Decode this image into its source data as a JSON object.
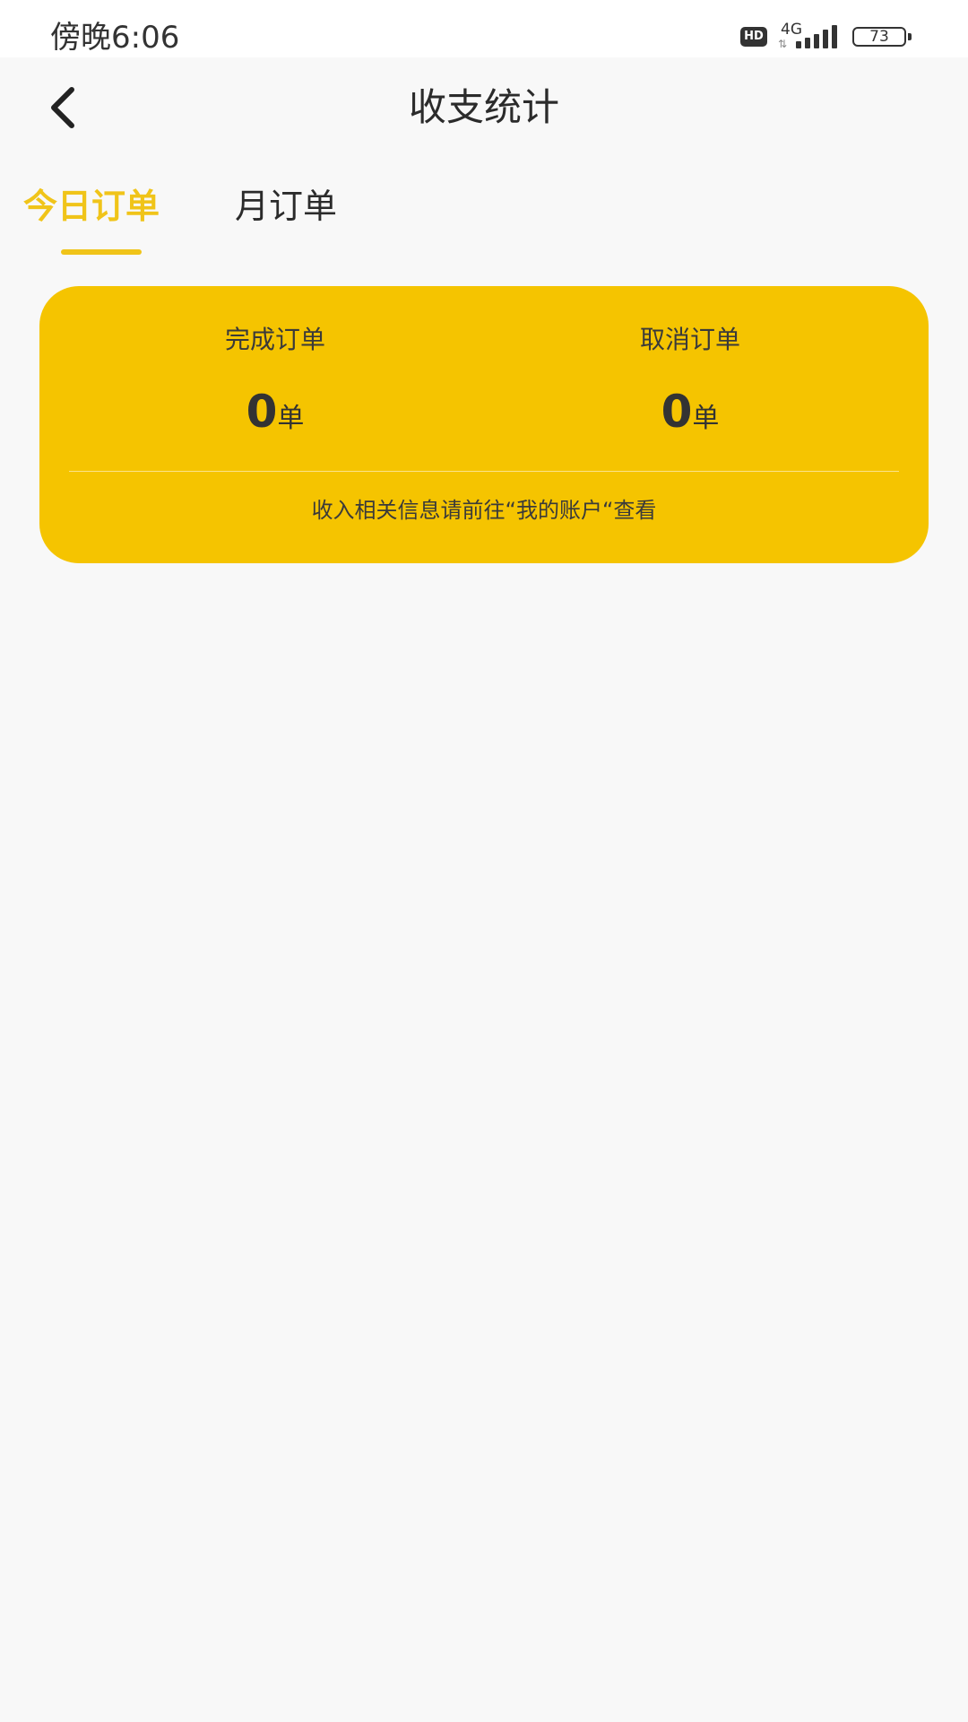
{
  "status_bar": {
    "time": "傍晚6:06",
    "hd": "HD",
    "network": "4G",
    "network_arrows": "⇅",
    "battery": "73"
  },
  "header": {
    "back_icon": "chevron-left-icon",
    "title": "收支统计"
  },
  "tabs": [
    {
      "label": "今日订单",
      "active": true
    },
    {
      "label": "月订单",
      "active": false
    }
  ],
  "stats": {
    "completed": {
      "label": "完成订单",
      "value": "0",
      "unit": "单"
    },
    "cancelled": {
      "label": "取消订单",
      "value": "0",
      "unit": "单"
    },
    "note": "收入相关信息请前往“我的账户“查看"
  },
  "colors": {
    "accent": "#f0c419",
    "card": "#f5c400",
    "background": "#f8f8f8"
  }
}
